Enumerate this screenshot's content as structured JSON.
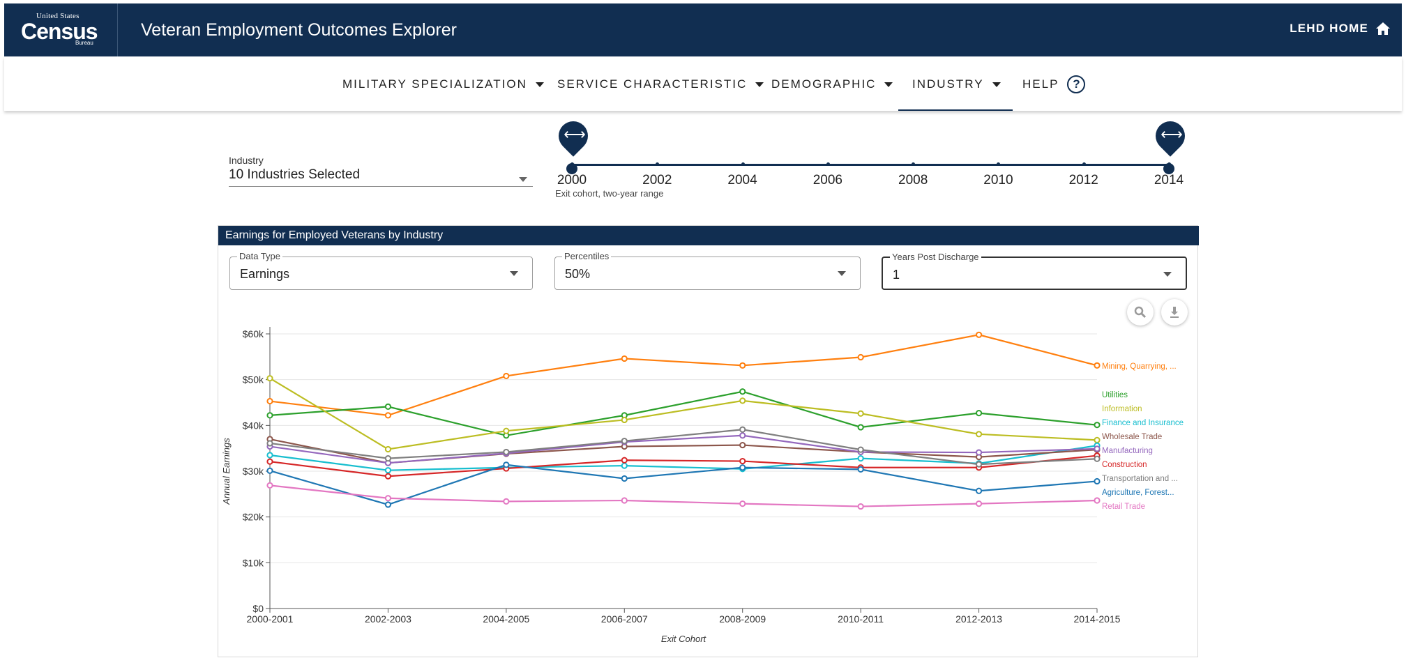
{
  "header": {
    "logo_top": "United States",
    "logo_main": "Census",
    "logo_bottom": "Bureau",
    "title": "Veteran Employment Outcomes Explorer",
    "home_link": "LEHD HOME"
  },
  "nav": {
    "items": [
      {
        "label": "MILITARY SPECIALIZATION"
      },
      {
        "label": "SERVICE CHARACTERISTIC"
      },
      {
        "label": "DEMOGRAPHIC"
      },
      {
        "label": "INDUSTRY"
      },
      {
        "label": "HELP"
      }
    ],
    "help_glyph": "?",
    "active": "INDUSTRY"
  },
  "filters": {
    "industry_label": "Industry",
    "industry_value": "10 Industries Selected",
    "slider": {
      "years": [
        "2000",
        "2002",
        "2004",
        "2006",
        "2008",
        "2010",
        "2012",
        "2014"
      ],
      "range_start": "2000",
      "range_end": "2014",
      "caption": "Exit cohort, two-year range",
      "handle_icon": "double-arrow-icon"
    }
  },
  "panel": {
    "title": "Earnings for Employed Veterans by Industry",
    "data_type": {
      "legend": "Data Type",
      "value": "Earnings"
    },
    "percentiles": {
      "legend": "Percentiles",
      "value": "50%"
    },
    "years_post": {
      "legend": "Years Post Discharge",
      "value": "1"
    },
    "icons": [
      "zoom-icon",
      "download-icon"
    ]
  },
  "chart_data": {
    "type": "line",
    "xlabel": "Exit Cohort",
    "ylabel": "Annual Earnings",
    "categories": [
      "2000-2001",
      "2002-2003",
      "2004-2005",
      "2006-2007",
      "2008-2009",
      "2010-2011",
      "2012-2013",
      "2014-2015"
    ],
    "y_ticks": [
      "$0",
      "$10k",
      "$20k",
      "$30k",
      "$40k",
      "$50k",
      "$60k"
    ],
    "ylim": [
      0,
      60000
    ],
    "legend_placement": "right (line-end labels)",
    "grid": "horizontal",
    "series": [
      {
        "name": "Mining, Quarrying, ...",
        "color": "#ff7f0e",
        "values": [
          45300,
          42200,
          50800,
          54600,
          53100,
          54900,
          59800,
          53100
        ]
      },
      {
        "name": "Utilities",
        "color": "#2ca02c",
        "values": [
          42200,
          44100,
          37800,
          42200,
          47400,
          39600,
          42700,
          40100
        ]
      },
      {
        "name": "Information",
        "color": "#bcbd22",
        "values": [
          50300,
          34800,
          38800,
          41200,
          45400,
          42600,
          38100,
          36800
        ]
      },
      {
        "name": "Finance and Insurance",
        "color": "#17becf",
        "values": [
          33500,
          30200,
          30800,
          31200,
          30500,
          32800,
          31700,
          35600
        ]
      },
      {
        "name": "Wholesale Trade",
        "color": "#8c564b",
        "values": [
          37000,
          31800,
          33800,
          35400,
          35700,
          34200,
          33100,
          34700
        ]
      },
      {
        "name": "Manufacturing",
        "color": "#9467bd",
        "values": [
          35400,
          31800,
          33900,
          36400,
          37800,
          34200,
          34100,
          34900
        ]
      },
      {
        "name": "Construction",
        "color": "#d62728",
        "values": [
          32100,
          28900,
          30600,
          32400,
          32200,
          30800,
          30800,
          33400
        ]
      },
      {
        "name": "Transportation and ...",
        "color": "#7f7f7f",
        "values": [
          36100,
          32800,
          34200,
          36600,
          39100,
          34700,
          31500,
          32700
        ]
      },
      {
        "name": "Agriculture, Forest...",
        "color": "#1f77b4",
        "values": [
          30100,
          22700,
          31400,
          28400,
          30800,
          30400,
          25700,
          27800
        ]
      },
      {
        "name": "Retail Trade",
        "color": "#e377c2",
        "values": [
          26900,
          24100,
          23400,
          23600,
          22900,
          22300,
          22900,
          23600
        ]
      }
    ]
  }
}
